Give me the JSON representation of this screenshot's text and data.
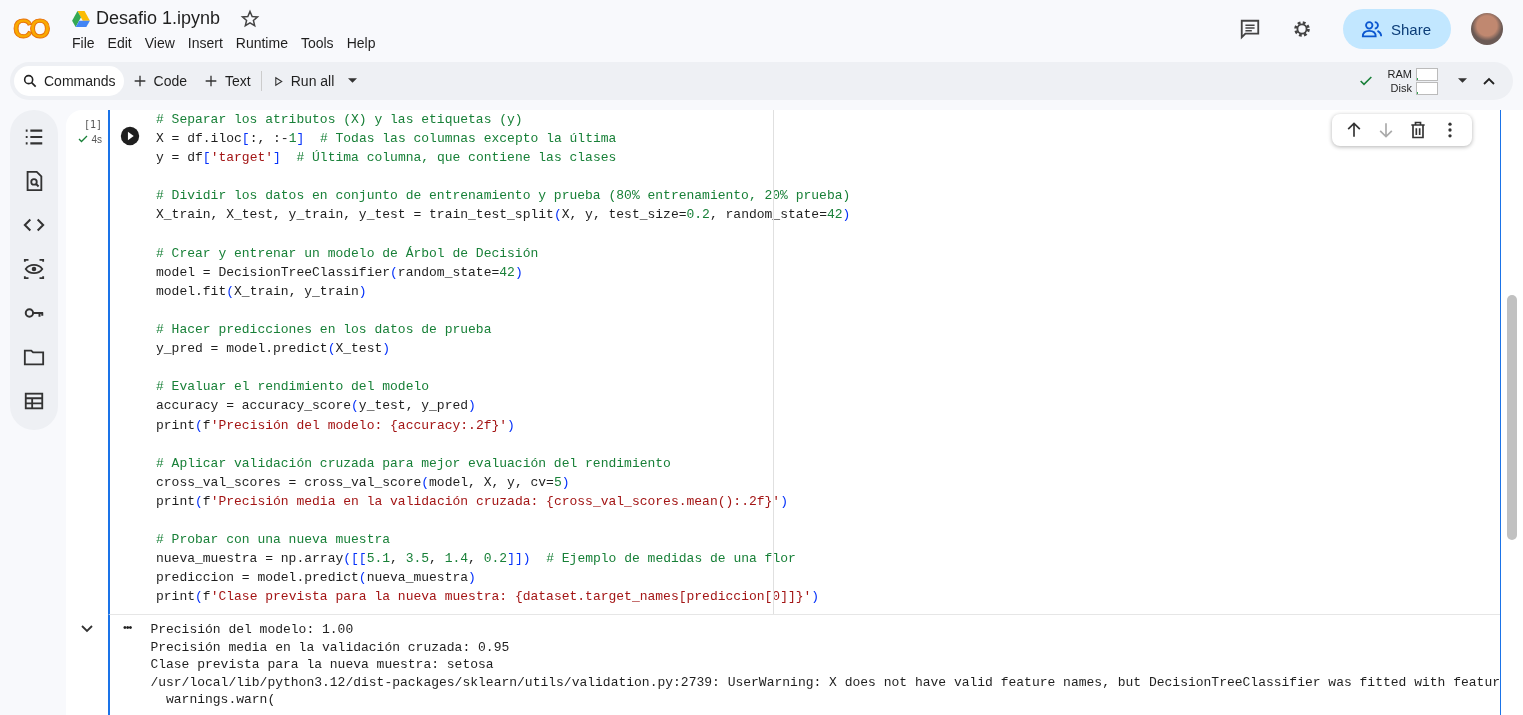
{
  "header": {
    "logo": "CO",
    "title": "Desafio 1.ipynb",
    "menu": [
      "File",
      "Edit",
      "View",
      "Insert",
      "Runtime",
      "Tools",
      "Help"
    ],
    "share": "Share"
  },
  "toolbar": {
    "commands": "Commands",
    "add_code": "Code",
    "add_text": "Text",
    "run_all": "Run all",
    "resources": [
      {
        "label": "RAM",
        "level": 0.05
      },
      {
        "label": "Disk",
        "level": 0.05
      }
    ]
  },
  "cell": {
    "execution_count": "[1]",
    "duration": "4s",
    "code_blocks": [
      [
        "# Separar los atributos (X) y las etiquetas (y)",
        "X = df.iloc[:, :-1]  # Todas las columnas excepto la última",
        "y = df['target']  # Última columna, que contiene las clases"
      ],
      [
        "# Dividir los datos en conjunto de entrenamiento y prueba (80% entrenamiento, 20% prueba)",
        "X_train, X_test, y_train, y_test = train_test_split(X, y, test_size=0.2, random_state=42)"
      ],
      [
        "# Crear y entrenar un modelo de Árbol de Decisión",
        "model = DecisionTreeClassifier(random_state=42)",
        "model.fit(X_train, y_train)"
      ],
      [
        "# Hacer predicciones en los datos de prueba",
        "y_pred = model.predict(X_test)"
      ],
      [
        "# Evaluar el rendimiento del modelo",
        "accuracy = accuracy_score(y_test, y_pred)",
        "print(f'Precisión del modelo: {accuracy:.2f}')"
      ],
      [
        "# Aplicar validación cruzada para mejor evaluación del rendimiento",
        "cross_val_scores = cross_val_score(model, X, y, cv=5)",
        "print(f'Precisión media en la validación cruzada: {cross_val_scores.mean():.2f}')"
      ],
      [
        "# Probar con una nueva muestra",
        "nueva_muestra = np.array([[5.1, 3.5, 1.4, 0.2]])  # Ejemplo de medidas de una flor",
        "prediccion = model.predict(nueva_muestra)",
        "print(f'Clase prevista para la nueva muestra: {dataset.target_names[prediccion[0]]}')"
      ]
    ],
    "output_menu": "•••",
    "output": [
      "Precisión del modelo: 1.00",
      "Precisión media en la validación cruzada: 0.95",
      "Clase prevista para la nueva muestra: setosa",
      "/usr/local/lib/python3.12/dist-packages/sklearn/utils/validation.py:2739: UserWarning: X does not have valid feature names, but DecisionTreeClassifier was fitted with featur",
      "  warnings.warn("
    ]
  }
}
